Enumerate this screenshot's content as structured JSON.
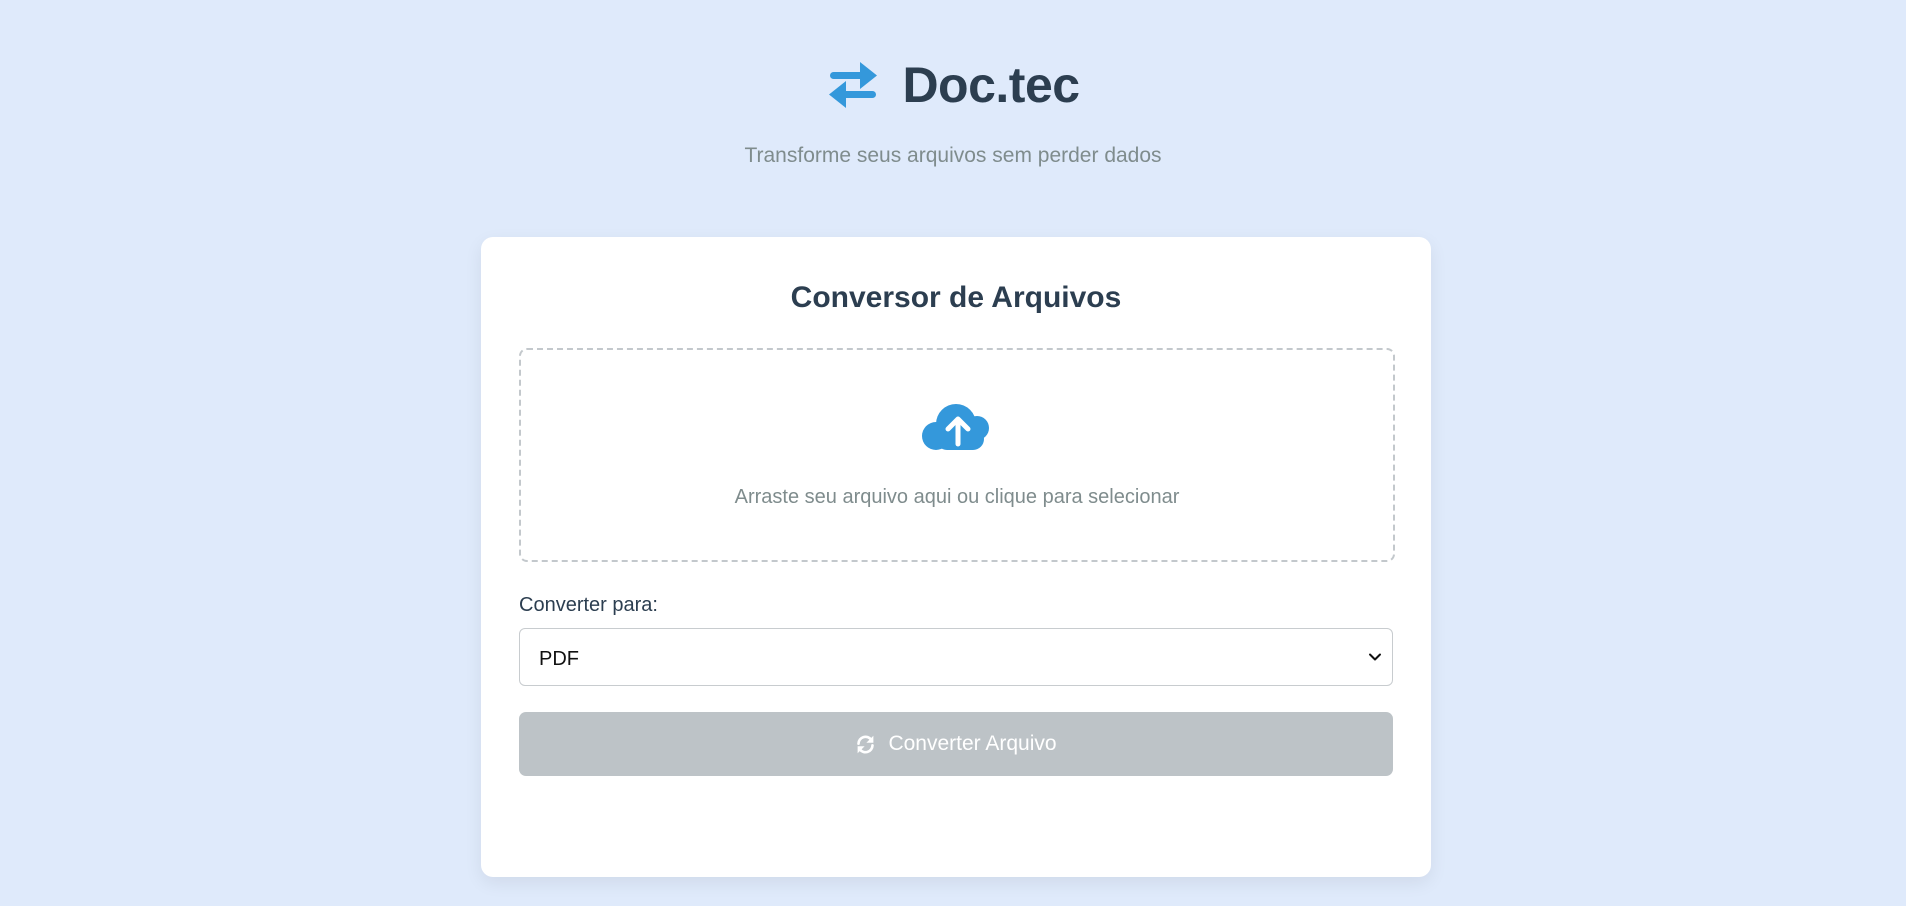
{
  "header": {
    "brand_icon": "exchange-arrows-icon",
    "title": "Doc.tec",
    "subtitle": "Transforme seus arquivos sem perder dados"
  },
  "converter": {
    "title": "Conversor de Arquivos",
    "dropzone": {
      "icon": "cloud-upload-icon",
      "text": "Arraste seu arquivo aqui ou clique para selecionar"
    },
    "format_label": "Converter para:",
    "format_selected": "PDF",
    "convert_button": {
      "icon": "sync-icon",
      "label": "Converter Arquivo",
      "disabled": true
    }
  },
  "colors": {
    "background": "#dfeafb",
    "accent": "#3498db",
    "text_dark": "#2c3e50",
    "text_muted": "#7f8c8d",
    "button_disabled": "#bdc3c7"
  }
}
